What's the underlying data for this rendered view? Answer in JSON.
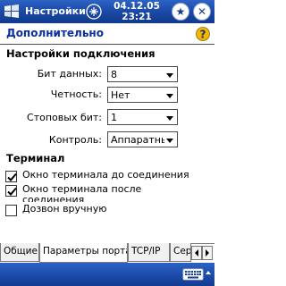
{
  "titlebar": {
    "app_title": "Настройки",
    "date": "04.12.05",
    "time": "23:21",
    "star_glyph": "★",
    "close_glyph": "✕"
  },
  "header": {
    "title": "Дополнительно",
    "help_glyph": "?"
  },
  "connection": {
    "section_title": "Настройки подключения",
    "fields": [
      {
        "label": "Бит данных:",
        "value": "8"
      },
      {
        "label": "Четность:",
        "value": "Нет"
      },
      {
        "label": "Стоповых бит:",
        "value": "1"
      },
      {
        "label": "Контроль:",
        "value": "Аппаратнь"
      }
    ]
  },
  "terminal": {
    "section_title": "Терминал",
    "options": [
      {
        "label": "Окно терминала до соединения",
        "checked": true
      },
      {
        "label": "Окно терминала после соединения",
        "checked": true
      },
      {
        "label": "Дозвон вручную",
        "checked": false
      }
    ]
  },
  "tabs": [
    {
      "label": "Общие",
      "active": false
    },
    {
      "label": "Параметры порта",
      "active": true
    },
    {
      "label": "TCP/IP",
      "active": false
    },
    {
      "label": "Сер",
      "active": false
    }
  ],
  "colors": {
    "titlebar": "#1a47a3",
    "header_text": "#0a2fa0",
    "help_icon": "#f0b800"
  },
  "icons": {
    "start": "windows-flag-icon",
    "tray": "connectivity-icon",
    "help": "help-icon",
    "keyboard": "keyboard-icon"
  }
}
